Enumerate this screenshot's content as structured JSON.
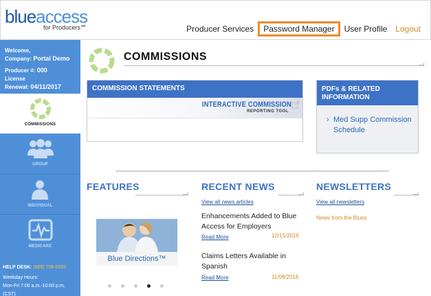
{
  "header": {
    "logo_part1": "blue",
    "logo_part2": "access",
    "logo_sub": "for Producers℠",
    "nav": [
      {
        "label": "Producer Services",
        "active": false
      },
      {
        "label": "Password Manager",
        "active": true
      },
      {
        "label": "User Profile",
        "active": false
      },
      {
        "label": "Logout",
        "active": false
      }
    ]
  },
  "sidebar": {
    "welcome_label": "Welcome,",
    "company_label": "Company:",
    "company_value": "Portal Demo",
    "producer_label": "Producer #:",
    "producer_value": "000",
    "license_label": "License",
    "renewal_label": "Renewal:",
    "renewal_value": "04/11/2017",
    "items": [
      {
        "label": "COMMISSIONS",
        "active": true,
        "icon": "commissions-ring-icon"
      },
      {
        "label": "GROUP",
        "active": false,
        "icon": "group-icon"
      },
      {
        "label": "INDIVIDUAL",
        "active": false,
        "icon": "individual-icon"
      },
      {
        "label": "MEDICARE",
        "active": false,
        "icon": "medicare-icon"
      }
    ],
    "helpdesk_label": "HELP DESK:",
    "helpdesk_phone": "(888) 706-0583",
    "hours_label": "Weekday Hours:",
    "hours_value": "Mon-Fri 7:00 a.m.-10:00 p.m.",
    "timezone": "(CST)"
  },
  "main": {
    "page_title": "COMMISSIONS",
    "commission_statements": {
      "header": "COMMISSION STATEMENTS",
      "tool_title": "INTERACTIVE COMMISSION",
      "tool_subtitle": "REPORTING TOOL"
    },
    "pdfs": {
      "header_line1": "PDFs & RELATED",
      "header_line2": "INFORMATION",
      "link": "Med Supp Commission Schedule"
    },
    "features": {
      "title": "FEATURES",
      "banner_caption": "Blue Directions™",
      "dot_count": 5,
      "active_dot": 3
    },
    "news": {
      "title": "RECENT NEWS",
      "view_all": "View all news articles",
      "read_more": "Read More",
      "items": [
        {
          "title": "Enhancements Added to Blue Access for Employers",
          "date": "12/15/2016"
        },
        {
          "title": "Claims Letters Available in Spanish",
          "date": "11/08/2016"
        }
      ]
    },
    "newsletters": {
      "title": "NEWSLETTERS",
      "view_all": "View all newsletters",
      "item": "News from the Blues"
    }
  },
  "colors": {
    "brand_blue": "#3d72c6",
    "sidebar_blue": "#4f8fd8",
    "accent_orange": "#f08a2e",
    "ring_green": "#b9dc8f"
  }
}
